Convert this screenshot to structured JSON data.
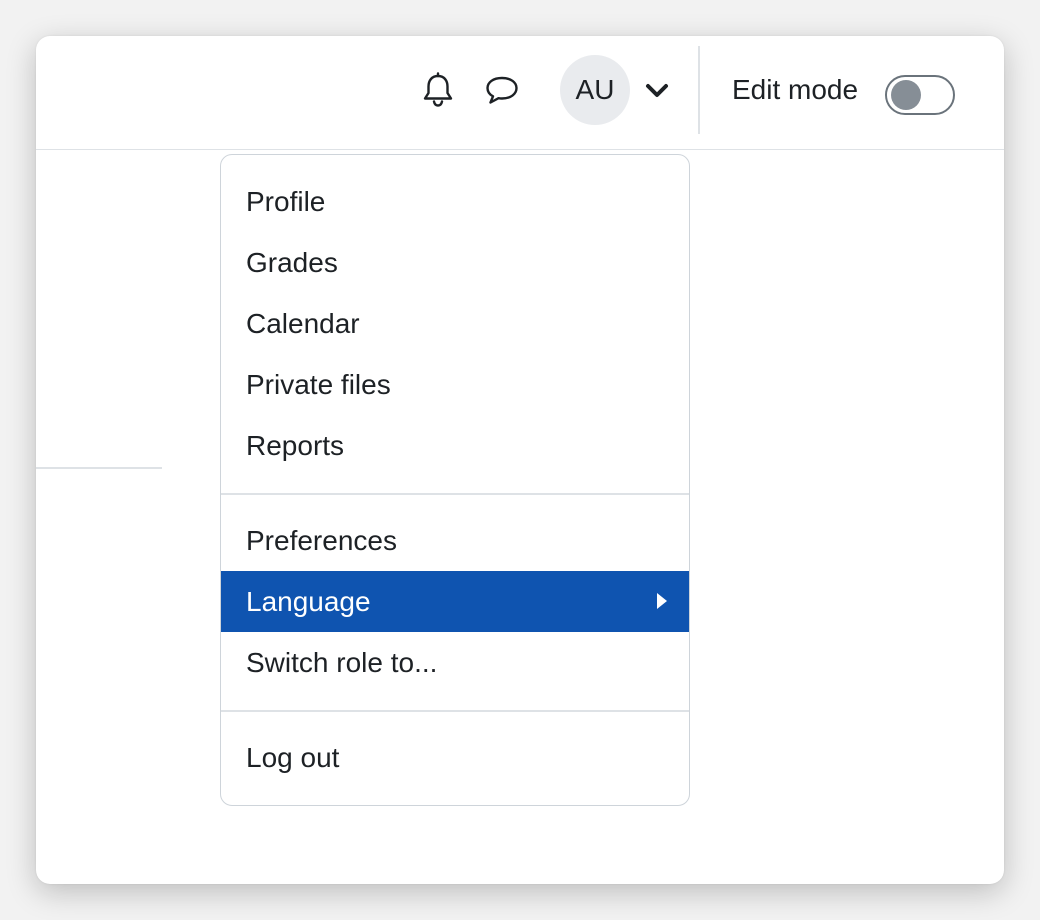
{
  "navbar": {
    "notifications_icon": "bell-icon",
    "messages_icon": "chat-bubble-icon",
    "avatar_initials": "AU",
    "user_menu_icon": "chevron-down-icon",
    "edit_mode_label": "Edit mode",
    "edit_mode_on": false
  },
  "user_menu": {
    "groups": [
      [
        "Profile",
        "Grades",
        "Calendar",
        "Private files",
        "Reports"
      ],
      [
        "Preferences",
        "Language",
        "Switch role to..."
      ],
      [
        "Log out"
      ]
    ],
    "items": {
      "profile": "Profile",
      "grades": "Grades",
      "calendar": "Calendar",
      "private_files": "Private files",
      "reports": "Reports",
      "preferences": "Preferences",
      "language": "Language",
      "switch_role": "Switch role to...",
      "log_out": "Log out"
    },
    "highlighted_item": "Language",
    "highlight_color": "#0f54b0"
  }
}
